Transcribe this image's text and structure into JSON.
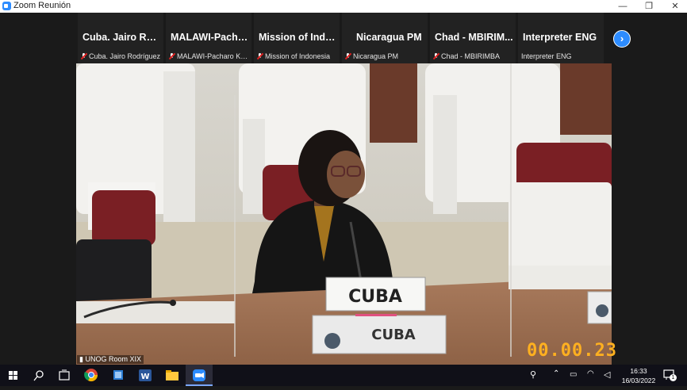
{
  "window": {
    "title": "Zoom Reunión"
  },
  "participants": [
    {
      "name": "Cuba. Jairo Rod...",
      "label": "Cuba. Jairo Rodríguez",
      "muted": true
    },
    {
      "name": "MALAWI-Pacha...",
      "label": "MALAWI-Pacharo Kayi...",
      "muted": true
    },
    {
      "name": "Mission of Indo...",
      "label": "Mission of Indonesia",
      "muted": true
    },
    {
      "name": "Nicaragua PM",
      "label": "Nicaragua PM",
      "muted": true
    },
    {
      "name": "Chad - MBIRIM...",
      "label": "Chad - MBIRIMBA",
      "muted": true
    },
    {
      "name": "Interpreter ENG",
      "label": "Interpreter ENG",
      "muted": false
    }
  ],
  "video": {
    "nameplate_front": "CUBA",
    "nameplate_desk": "CUBA",
    "room_label": "UNOG Room XIX",
    "timer": "00.00.23"
  },
  "taskbar": {
    "time": "16:33",
    "date": "16/03/2022",
    "notification_count": "1"
  },
  "colors": {
    "zoom_blue": "#2d8cff",
    "timer": "#ffb020",
    "mute_red": "#e02020"
  }
}
